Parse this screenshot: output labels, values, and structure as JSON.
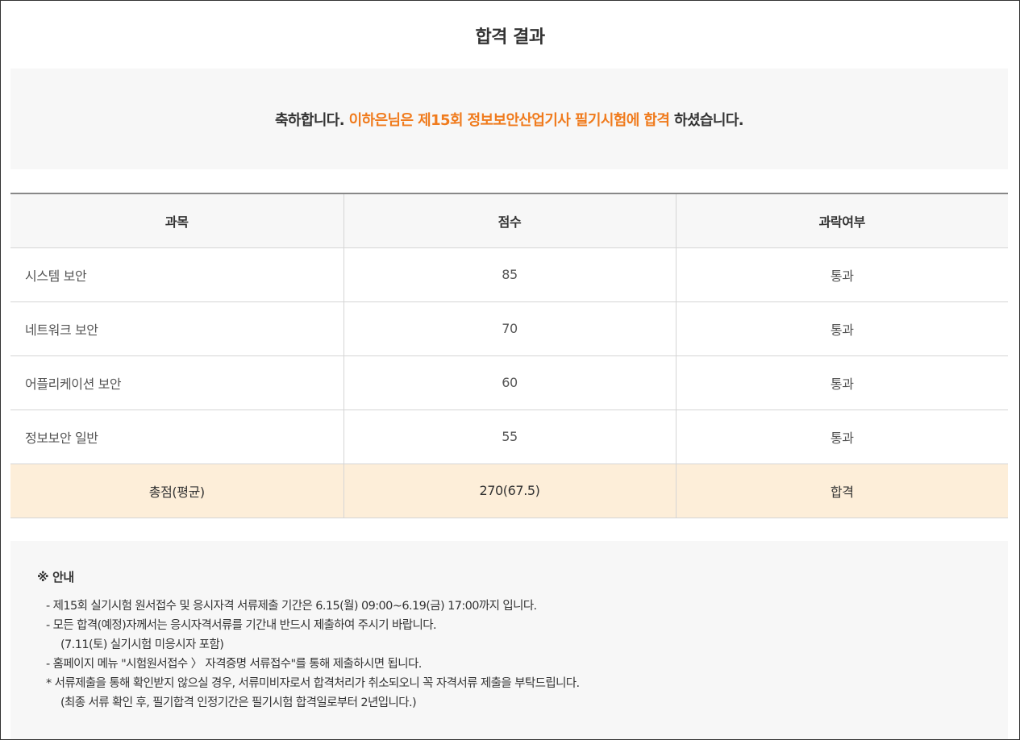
{
  "page": {
    "title": "합격 결과"
  },
  "congrats": {
    "prefix": "축하합니다. ",
    "highlight": "이하은님은 제15회 정보보안산업기사 필기시험에 합격",
    "suffix": " 하셨습니다."
  },
  "table": {
    "headers": [
      "과목",
      "점수",
      "과락여부"
    ],
    "rows": [
      {
        "subject": "시스템 보안",
        "score": "85",
        "status": "통과"
      },
      {
        "subject": "네트워크 보안",
        "score": "70",
        "status": "통과"
      },
      {
        "subject": "어플리케이션 보안",
        "score": "60",
        "status": "통과"
      },
      {
        "subject": "정보보안 일반",
        "score": "55",
        "status": "통과"
      }
    ],
    "total": {
      "label": "총점(평균)",
      "score": "270(67.5)",
      "result": "합격"
    }
  },
  "notice": {
    "title": "※ 안내",
    "lines": [
      "- 제15회 실기시험 원서접수 및 응시자격 서류제출 기간은 6.15(월) 09:00~6.19(금) 17:00까지 입니다.",
      "- 모든 합격(예정)자께서는 응시자격서류를 기간내 반드시 제출하여 주시기 바랍니다.",
      "(7.11(토) 실기시험 미응시자 포함)",
      "- 홈페이지 메뉴 \"시험원서접수 〉 자격증명 서류접수\"를 통해 제출하시면 됩니다.",
      "* 서류제출을 통해 확인받지 않으실 경우, 서류미비자로서 합격처리가 취소되오니 꼭 자격서류 제출을 부탁드립니다.",
      "(최종 서류 확인 후, 필기합격 인정기간은 필기시험 합격일로부터 2년입니다.)"
    ]
  },
  "colors": {
    "accent": "#f07b1d",
    "total_row_bg": "#fdeed9",
    "panel_bg": "#f7f7f7"
  }
}
